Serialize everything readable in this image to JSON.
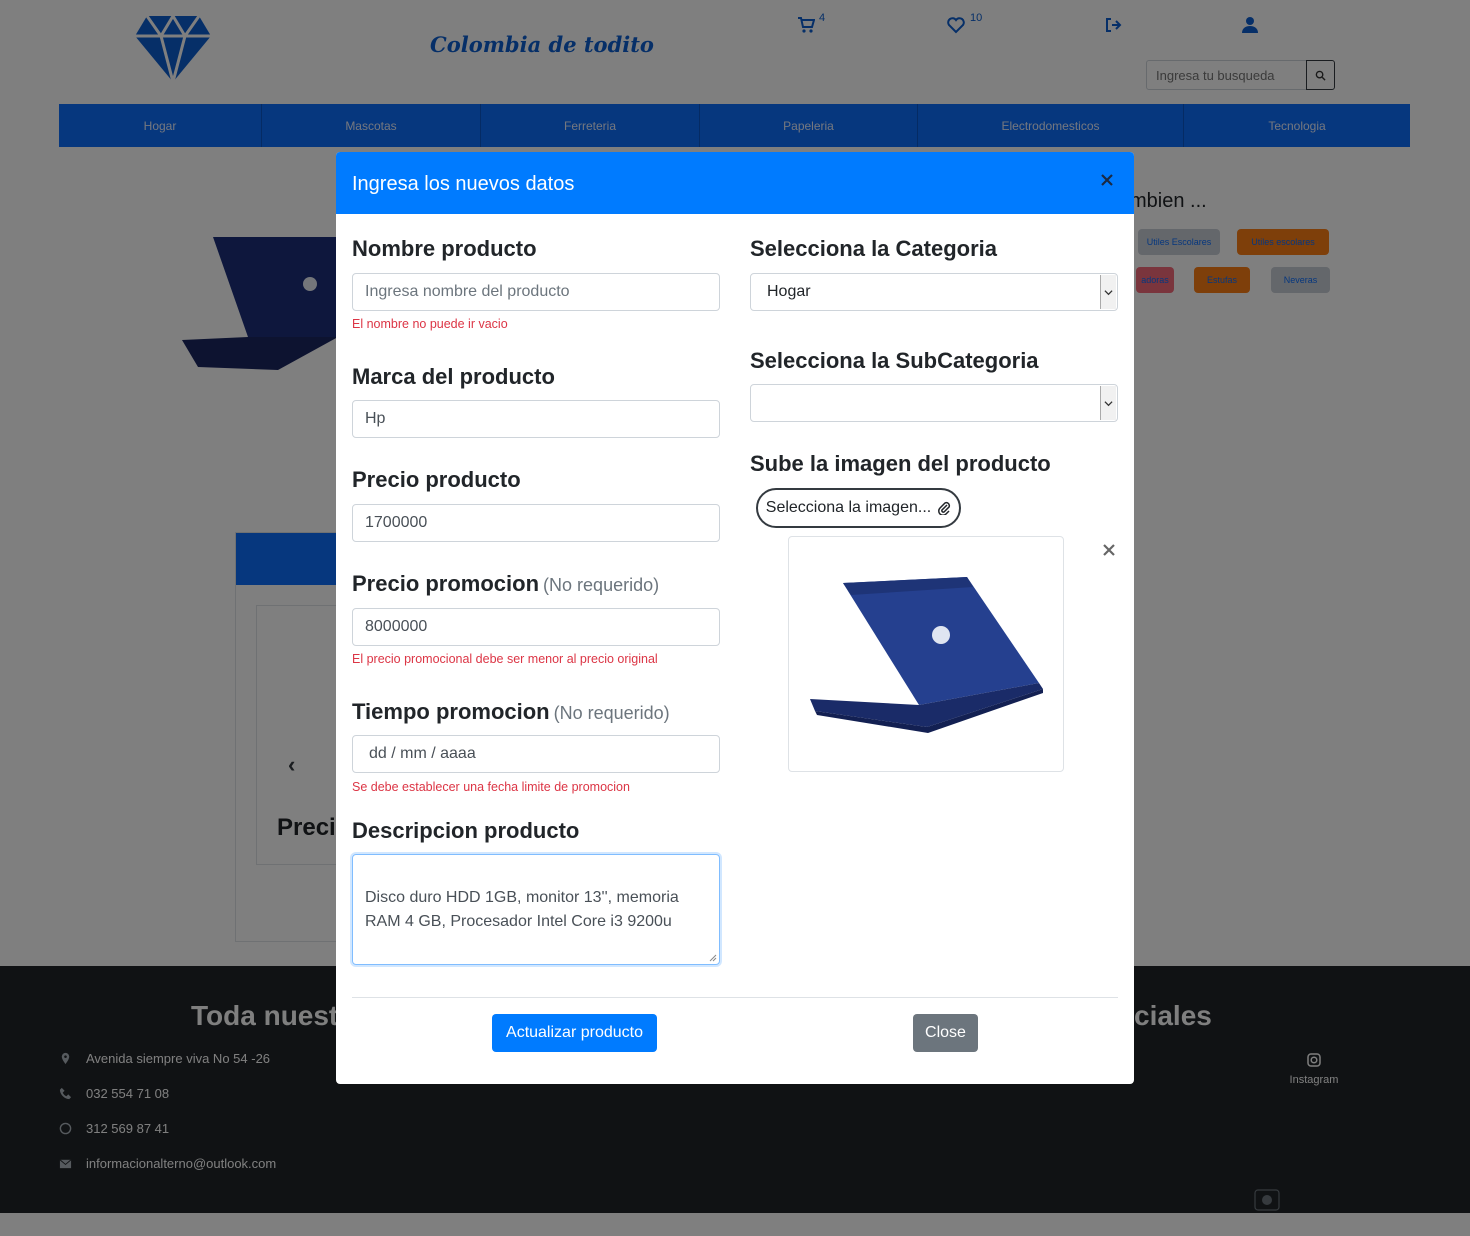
{
  "header": {
    "brand": "Colombia de todito",
    "cart_count": "4",
    "wishlist_count": "10",
    "search": {
      "placeholder": "Ingresa tu busqueda"
    }
  },
  "nav": {
    "items": [
      "Hogar",
      "Mascotas",
      "Ferreteria",
      "Papeleria",
      "Electrodomesticos",
      "Tecnologia"
    ]
  },
  "background": {
    "also_title": "mbien ...",
    "tags": [
      "Utiles Escolares",
      "Utiles escolares",
      "adoras",
      "Estufas",
      "Neveras"
    ],
    "preci_text": "Preci"
  },
  "modal": {
    "title": "Ingresa los nuevos datos",
    "fields": {
      "nombre": {
        "label": "Nombre producto",
        "placeholder": "Ingresa nombre del producto",
        "error": "El nombre no puede ir vacio"
      },
      "marca": {
        "label": "Marca del producto",
        "value": "Hp"
      },
      "precio": {
        "label": "Precio producto",
        "value": "1700000"
      },
      "precio_promo": {
        "label": "Precio promocion",
        "optional": "(No requerido)",
        "value": "8000000",
        "error": "El precio promocional debe ser menor al precio original"
      },
      "tiempo_promo": {
        "label": "Tiempo promocion",
        "optional": "(No requerido)",
        "value": "dd / mm / aaaa",
        "error": "Se debe establecer una fecha limite de promocion"
      },
      "descripcion": {
        "label": "Descripcion producto",
        "value": "Disco duro HDD 1GB, monitor 13'', memoria\nRAM 4 GB,  Procesador Intel Core i3 9200u"
      },
      "categoria": {
        "label": "Selecciona la Categoria",
        "value": "Hogar"
      },
      "subcategoria": {
        "label": "Selecciona la SubCategoria",
        "value": ""
      },
      "imagen": {
        "label": "Sube la imagen del producto",
        "button": "Selecciona la imagen..."
      }
    },
    "buttons": {
      "update": "Actualizar producto",
      "close": "Close"
    }
  },
  "footer": {
    "title_left": "Toda nuest",
    "title_right": "ciales",
    "address": "Avenida siempre viva No 54 -26",
    "phone": "032 554 71 08",
    "whatsapp": "312 569 87 41",
    "email": "informacionalterno@outlook.com",
    "social_instagram": "Instagram"
  },
  "colors": {
    "primary": "#007bff",
    "nav_blue": "#0d6efd",
    "danger": "#dc3545",
    "secondary": "#6c757d",
    "footer": "#212529"
  }
}
